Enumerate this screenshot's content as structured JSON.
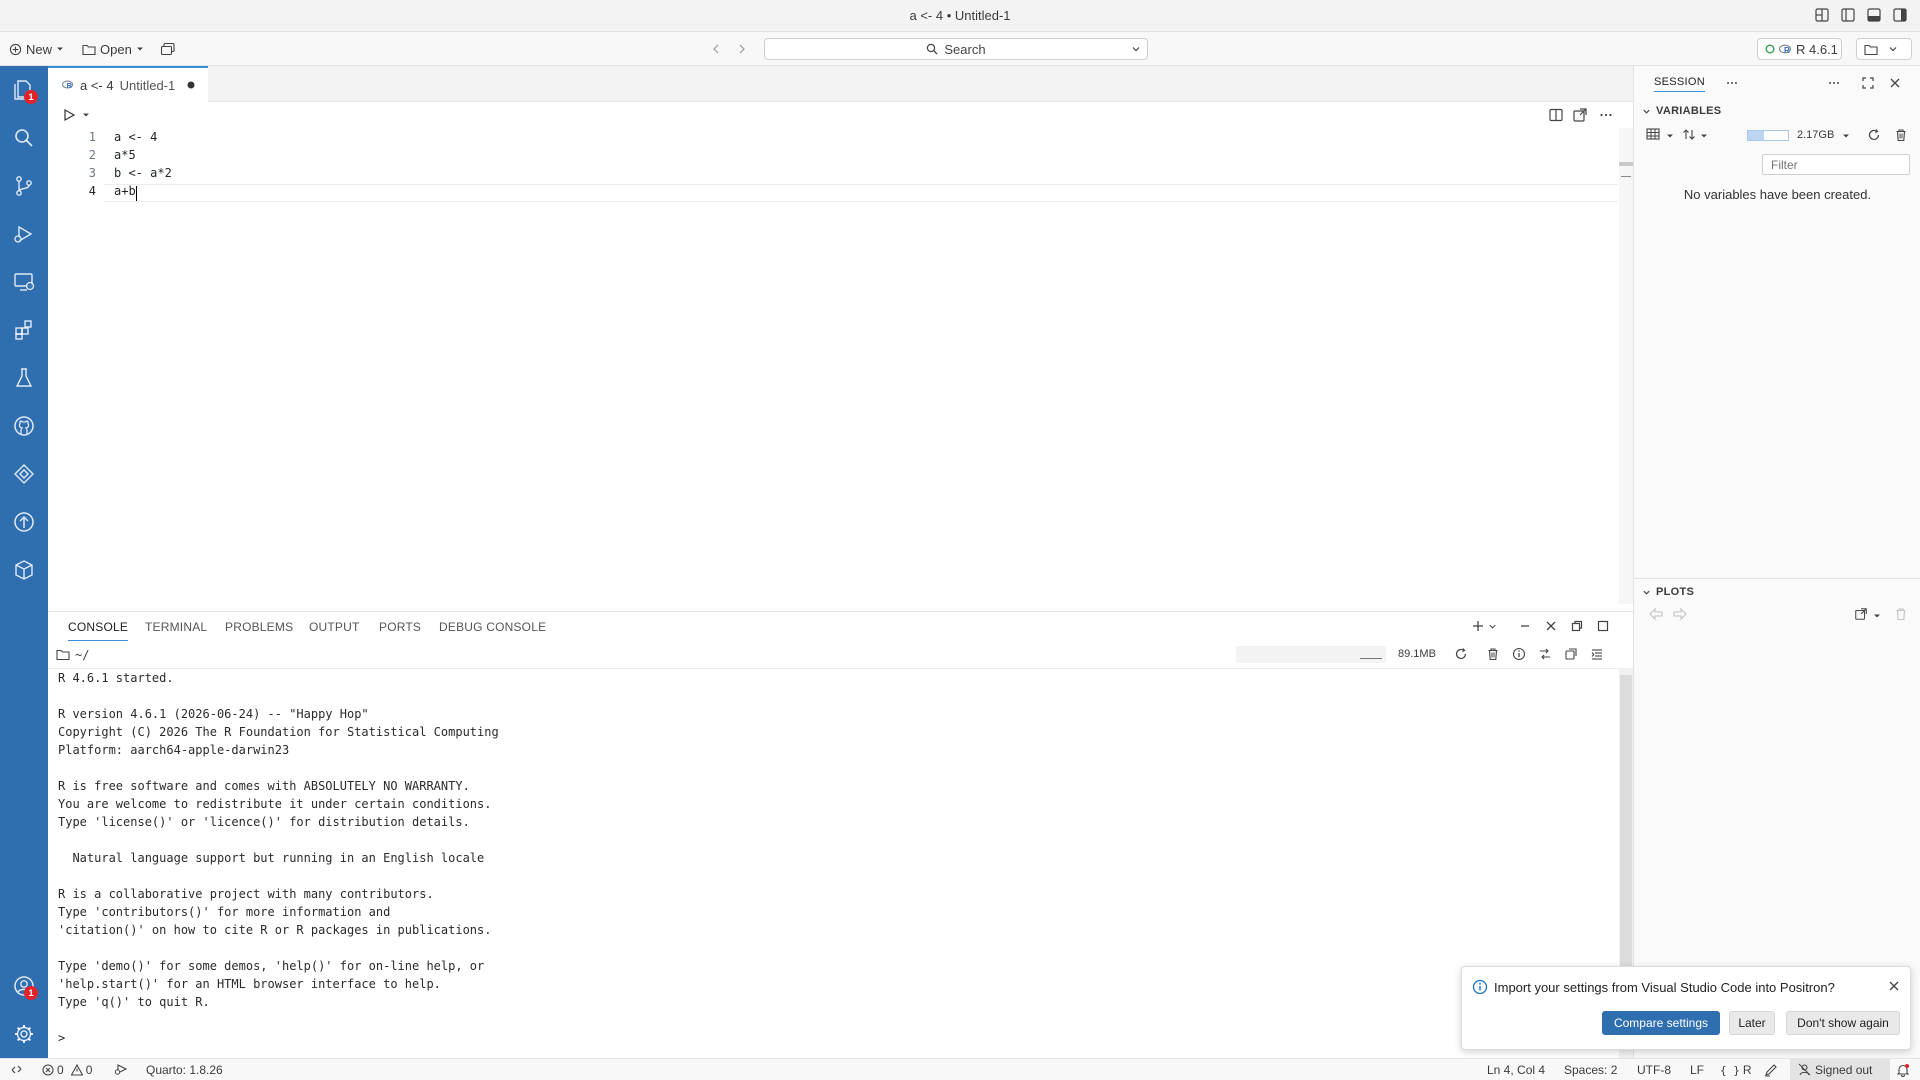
{
  "window": {
    "title": "a <- 4 • Untitled-1"
  },
  "toolbar": {
    "new_label": "New",
    "open_label": "Open",
    "search_label": "Search",
    "interpreter_label": "R 4.6.1"
  },
  "activity_bar": {
    "explorer_badge": "1",
    "account_badge": "1"
  },
  "editor": {
    "tab_label": "a <- 4",
    "tab_sublabel": "Untitled-1",
    "line_numbers": [
      "1",
      "2",
      "3",
      "4"
    ],
    "lines": [
      "a <- 4",
      "a*5",
      "b <- a*2",
      "a+b"
    ]
  },
  "panel": {
    "tabs": [
      "CONSOLE",
      "TERMINAL",
      "PROBLEMS",
      "OUTPUT",
      "PORTS",
      "DEBUG CONSOLE"
    ],
    "working_dir": "~/",
    "memory": "89.1MB",
    "console_lines": [
      "R 4.6.1 started.",
      "",
      "R version 4.6.1 (2026-06-24) -- \"Happy Hop\"",
      "Copyright (C) 2026 The R Foundation for Statistical Computing",
      "Platform: aarch64-apple-darwin23",
      "",
      "R is free software and comes with ABSOLUTELY NO WARRANTY.",
      "You are welcome to redistribute it under certain conditions.",
      "Type 'license()' or 'licence()' for distribution details.",
      "",
      "  Natural language support but running in an English locale",
      "",
      "R is a collaborative project with many contributors.",
      "Type 'contributors()' for more information and",
      "'citation()' on how to cite R or R packages in publications.",
      "",
      "Type 'demo()' for some demos, 'help()' for on-line help, or",
      "'help.start()' for an HTML browser interface to help.",
      "Type 'q()' to quit R.",
      "",
      ">"
    ]
  },
  "session": {
    "tab_label": "SESSION",
    "variables_header": "VARIABLES",
    "memory": "2.17GB",
    "filter_placeholder": "Filter",
    "empty_message": "No variables have been created.",
    "plots_header": "PLOTS"
  },
  "notification": {
    "message": "Import your settings from Visual Studio Code into Positron?",
    "primary_button": "Compare settings",
    "later_button": "Later",
    "dismiss_button": "Don't show again"
  },
  "statusbar": {
    "errors": "0",
    "warnings": "0",
    "quarto": "Quarto: 1.8.26",
    "cursor": "Ln 4, Col 4",
    "spaces": "Spaces: 2",
    "encoding": "UTF-8",
    "eol": "LF",
    "language": "R",
    "account": "Signed out"
  },
  "colors": {
    "activity_bar": "#2f6fb0",
    "accent": "#3b8ede",
    "primary_button": "#2f6fb0",
    "badge": "#e0242a"
  }
}
